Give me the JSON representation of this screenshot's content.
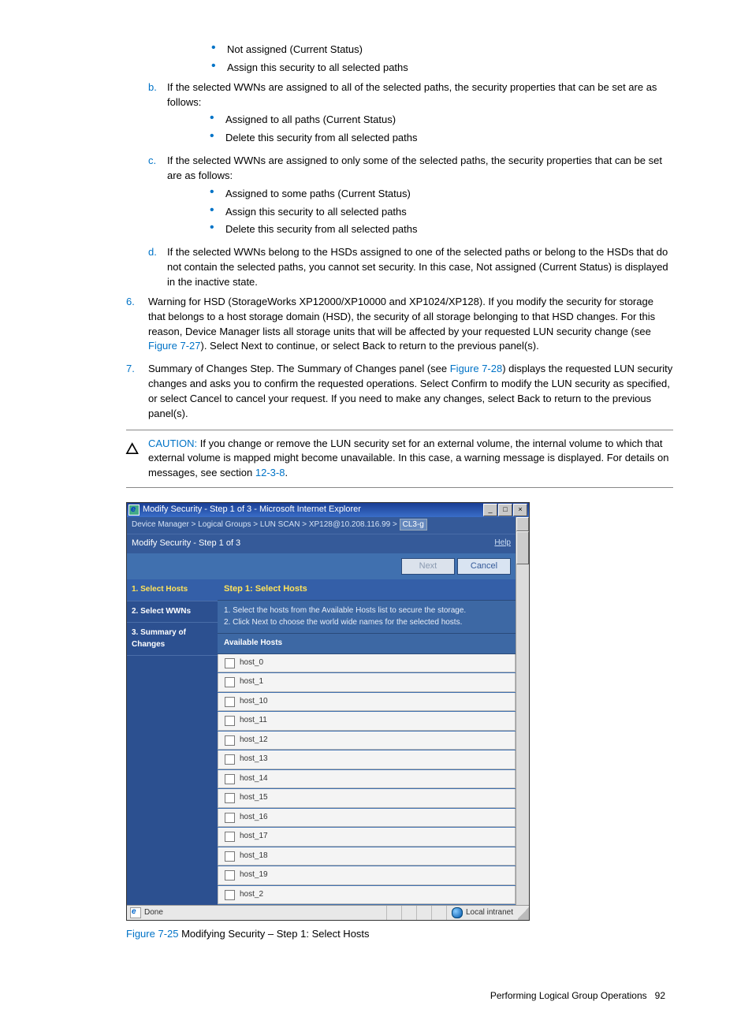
{
  "list_a_b1": "Not assigned (Current Status)",
  "list_a_b2": "Assign this security to all selected paths",
  "item_b_text": "If the selected WWNs are assigned to all of the selected paths, the security properties that can be set are as follows:",
  "list_b_b1": "Assigned to all paths (Current Status)",
  "list_b_b2": "Delete this security from all selected paths",
  "item_c_text": "If the selected WWNs are assigned to only some of the selected paths, the security properties that can be set are as follows:",
  "list_c_b1": "Assigned to some paths (Current Status)",
  "list_c_b2": "Assign this security to all selected paths",
  "list_c_b3": "Delete this security from all selected paths",
  "item_d_text": "If the selected WWNs belong to the HSDs assigned to one of the selected paths or belong to the HSDs that do not contain the selected paths, you cannot set security. In this case, Not assigned (Current Status) is displayed in the inactive state.",
  "step6_pre": "Warning for HSD (StorageWorks XP12000/XP10000 and XP1024/XP128). If you modify the security for storage that belongs to a host storage domain (HSD), the security of all storage belonging to that HSD changes. For this reason, Device Manager lists all storage units that will be affected by your requested LUN security change (see ",
  "step6_link": "Figure 7-27",
  "step6_post": "). Select Next to continue, or select Back to return to the previous panel(s).",
  "step7_pre": "Summary of Changes Step. The Summary of Changes panel (see ",
  "step7_link": "Figure 7-28",
  "step7_post": ") displays the requested LUN security changes and asks you to confirm the requested operations. Select Confirm to modify the LUN security as specified, or select Cancel to cancel your request. If you need to make any changes, select Back to return to the previous panel(s).",
  "caution_label": "CAUTION:",
  "caution_pre": "  If you change or remove the LUN security set for an external volume, the internal volume to which that external volume is mapped might become unavailable. In this case, a warning message is displayed. For details on messages, see section ",
  "caution_link": "12-3-8",
  "caution_post": ".",
  "ie": {
    "title": "Modify Security - Step 1 of 3 - Microsoft Internet Explorer",
    "crumb": "Device Manager > Logical Groups > LUN SCAN > XP128@10.208.116.99 > ",
    "crumb_last": "CL3-g",
    "wiz_title": "Modify Security - Step 1 of 3",
    "help": "Help",
    "btn_next": "Next",
    "btn_cancel": "Cancel",
    "nav1": "1. Select Hosts",
    "nav2": "2. Select WWNs",
    "nav3": "3. Summary of Changes",
    "sect_title": "Step 1: Select Hosts",
    "instr1": "1. Select the hosts from the Available Hosts list to secure the storage.",
    "instr2": "2. Click Next to choose the world wide names for the selected hosts.",
    "avh": "Available Hosts",
    "hosts": [
      "host_0",
      "host_1",
      "host_10",
      "host_11",
      "host_12",
      "host_13",
      "host_14",
      "host_15",
      "host_16",
      "host_17",
      "host_18",
      "host_19",
      "host_2"
    ],
    "status_done": "Done",
    "status_intranet": "Local intranet"
  },
  "fig_num": "Figure 7-25",
  "fig_caption": " Modifying Security – Step 1: Select Hosts",
  "footer_text": "Performing Logical Group Operations",
  "footer_page": "92"
}
